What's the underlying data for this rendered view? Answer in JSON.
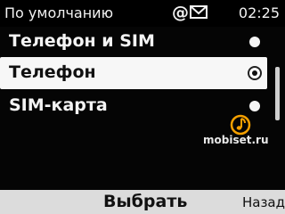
{
  "status_bar": {
    "title": "По умолчанию",
    "at_symbol": "@",
    "mail_icon": "mail-icon",
    "time": "02:25"
  },
  "list": {
    "items": [
      {
        "label": "Телефон и SIM",
        "selected": false
      },
      {
        "label": "Телефон",
        "selected": true
      },
      {
        "label": "SIM-карта",
        "selected": false
      }
    ]
  },
  "scrollbar": {
    "thumb_position": 0.5
  },
  "watermark": {
    "text": "mobiset.ru",
    "logo_icon": "music-note-logo-icon"
  },
  "softkeys": {
    "select_label": "Выбрать",
    "back_label": "Назад"
  },
  "colors": {
    "background": "#050505",
    "highlight": "#f7f7f7",
    "text": "#f4f4f4",
    "softkey_bar": "#dcdcdc",
    "logo_orange": "#f5a000"
  }
}
